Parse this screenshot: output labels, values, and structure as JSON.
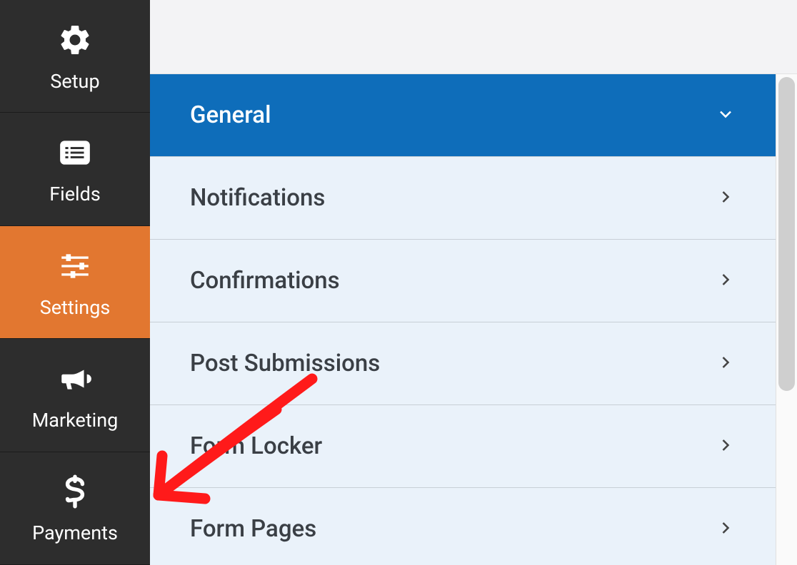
{
  "sidebar": {
    "items": [
      {
        "label": "Setup",
        "icon": "gear"
      },
      {
        "label": "Fields",
        "icon": "list"
      },
      {
        "label": "Settings",
        "icon": "sliders",
        "active": true
      },
      {
        "label": "Marketing",
        "icon": "bullhorn"
      },
      {
        "label": "Payments",
        "icon": "dollar"
      }
    ]
  },
  "settings_panel": {
    "items": [
      {
        "label": "General",
        "expanded": true
      },
      {
        "label": "Notifications",
        "expanded": false
      },
      {
        "label": "Confirmations",
        "expanded": false
      },
      {
        "label": "Post Submissions",
        "expanded": false
      },
      {
        "label": "Form Locker",
        "expanded": false
      },
      {
        "label": "Form Pages",
        "expanded": false
      }
    ]
  }
}
